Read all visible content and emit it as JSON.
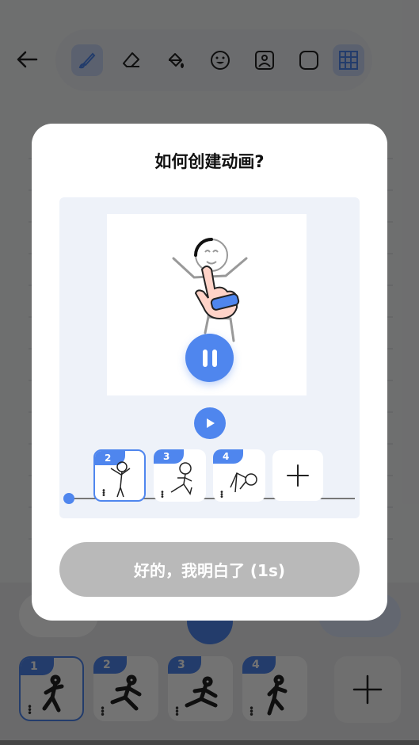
{
  "modal": {
    "title": "如何创建动画?",
    "confirm_label": "好的，我明白了 (1s)",
    "frames": [
      {
        "number": "2",
        "selected": true
      },
      {
        "number": "3",
        "selected": false
      },
      {
        "number": "4",
        "selected": false
      }
    ],
    "timeline_progress": 0.0
  },
  "background": {
    "frames": [
      {
        "number": "1",
        "selected": true
      },
      {
        "number": "2",
        "selected": false
      },
      {
        "number": "3",
        "selected": false
      },
      {
        "number": "4",
        "selected": false
      }
    ],
    "tools": [
      "brush-icon",
      "eraser-icon",
      "fill-bucket-icon",
      "emoji-icon",
      "image-icon",
      "shape-icon",
      "grid-icon"
    ],
    "active_tools": [
      "brush-icon",
      "grid-icon"
    ]
  },
  "colors": {
    "accent": "#4f86ee",
    "button_disabled": "#b9b9b9"
  }
}
